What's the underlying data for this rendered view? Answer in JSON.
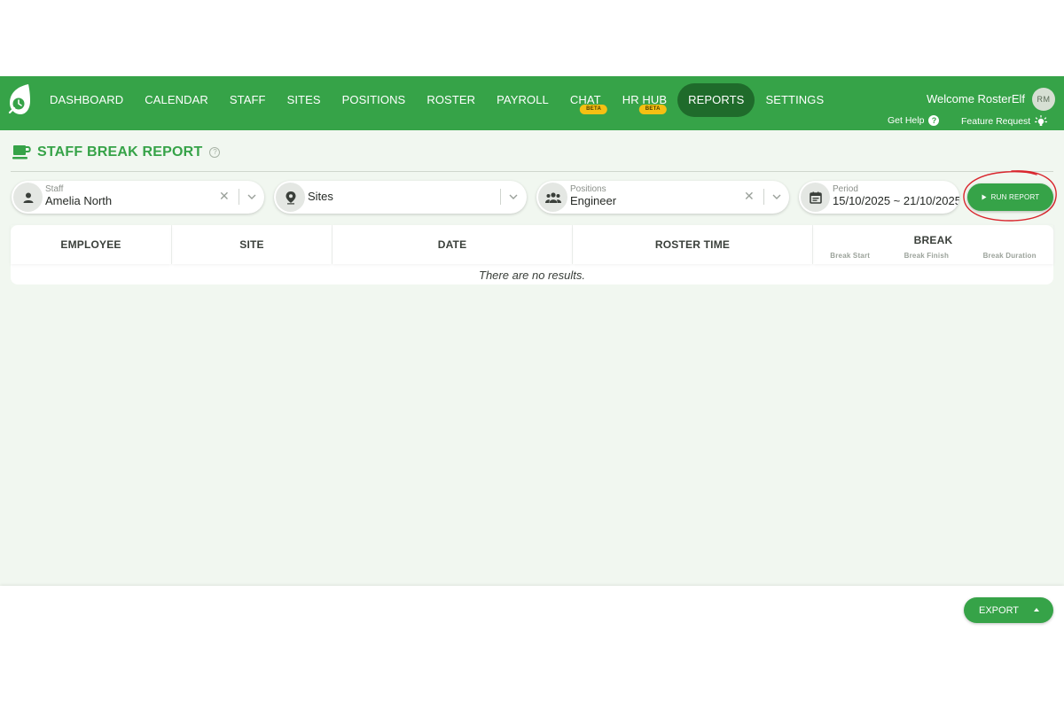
{
  "nav": {
    "items": [
      {
        "label": "DASHBOARD"
      },
      {
        "label": "CALENDAR"
      },
      {
        "label": "STAFF"
      },
      {
        "label": "SITES"
      },
      {
        "label": "POSITIONS"
      },
      {
        "label": "ROSTER"
      },
      {
        "label": "PAYROLL"
      },
      {
        "label": "CHAT",
        "badge": "BETA"
      },
      {
        "label": "HR HUB",
        "badge": "BETA"
      },
      {
        "label": "REPORTS",
        "active": true
      },
      {
        "label": "SETTINGS"
      }
    ],
    "welcome": "Welcome RosterElf",
    "avatar_initials": "RM",
    "help_label": "Get Help",
    "feature_label": "Feature Request"
  },
  "page": {
    "title": "STAFF BREAK REPORT",
    "help_icon": "?"
  },
  "filters": {
    "staff": {
      "label": "Staff",
      "value": "Amelia North",
      "icon": "person-icon"
    },
    "sites": {
      "placeholder": "Sites",
      "icon": "location-pin-icon"
    },
    "positions": {
      "label": "Positions",
      "value": "Engineer",
      "icon": "people-icon"
    },
    "period": {
      "label": "Period",
      "value": "15/10/2025 ~ 21/10/2025",
      "icon": "calendar-icon"
    }
  },
  "run_report": {
    "label": "RUN REPORT"
  },
  "table": {
    "columns": [
      "EMPLOYEE",
      "SITE",
      "DATE",
      "ROSTER TIME",
      "BREAK"
    ],
    "break_subcolumns": [
      "Break Start",
      "Break Finish",
      "Break Duration"
    ],
    "empty_message": "There are no results."
  },
  "footer": {
    "export_label": "EXPORT"
  },
  "colors": {
    "brand": "#36a348",
    "active_nav": "#1f6b2b",
    "beta": "#f5c013",
    "highlight_ring": "#d9262e"
  }
}
